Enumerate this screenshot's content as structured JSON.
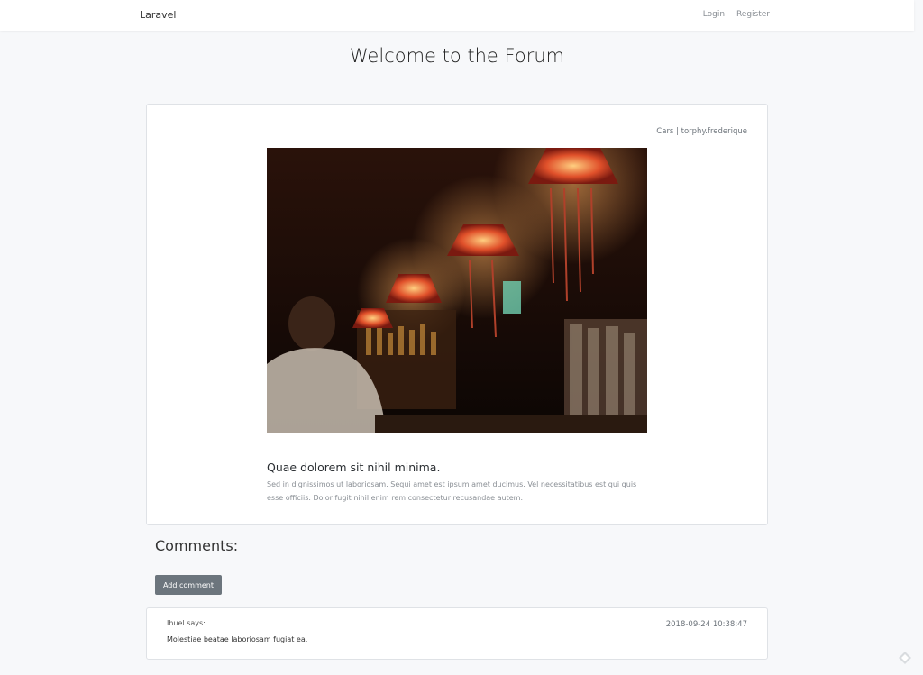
{
  "navbar": {
    "brand": "Laravel",
    "login": "Login",
    "register": "Register"
  },
  "page": {
    "title": "Welcome to the Forum"
  },
  "post": {
    "meta": "Cars | torphy.frederique",
    "title": "Quae dolorem sit nihil minima.",
    "body": "Sed in dignissimos ut laboriosam. Sequi amet est ipsum amet ducimus. Vel necessitatibus est qui quis esse officiis. Dolor fugit nihil enim rem consectetur recusandae autem."
  },
  "comments": {
    "heading": "Comments:",
    "add_label": "Add comment",
    "items": [
      {
        "author": "Ihuel says:",
        "date": "2018-09-24 10:38:47",
        "text": "Molestiae beatae laboriosam fugiat ea."
      }
    ]
  },
  "colors": {
    "page_bg": "#f7f8fa",
    "button_bg": "#6c757d"
  }
}
